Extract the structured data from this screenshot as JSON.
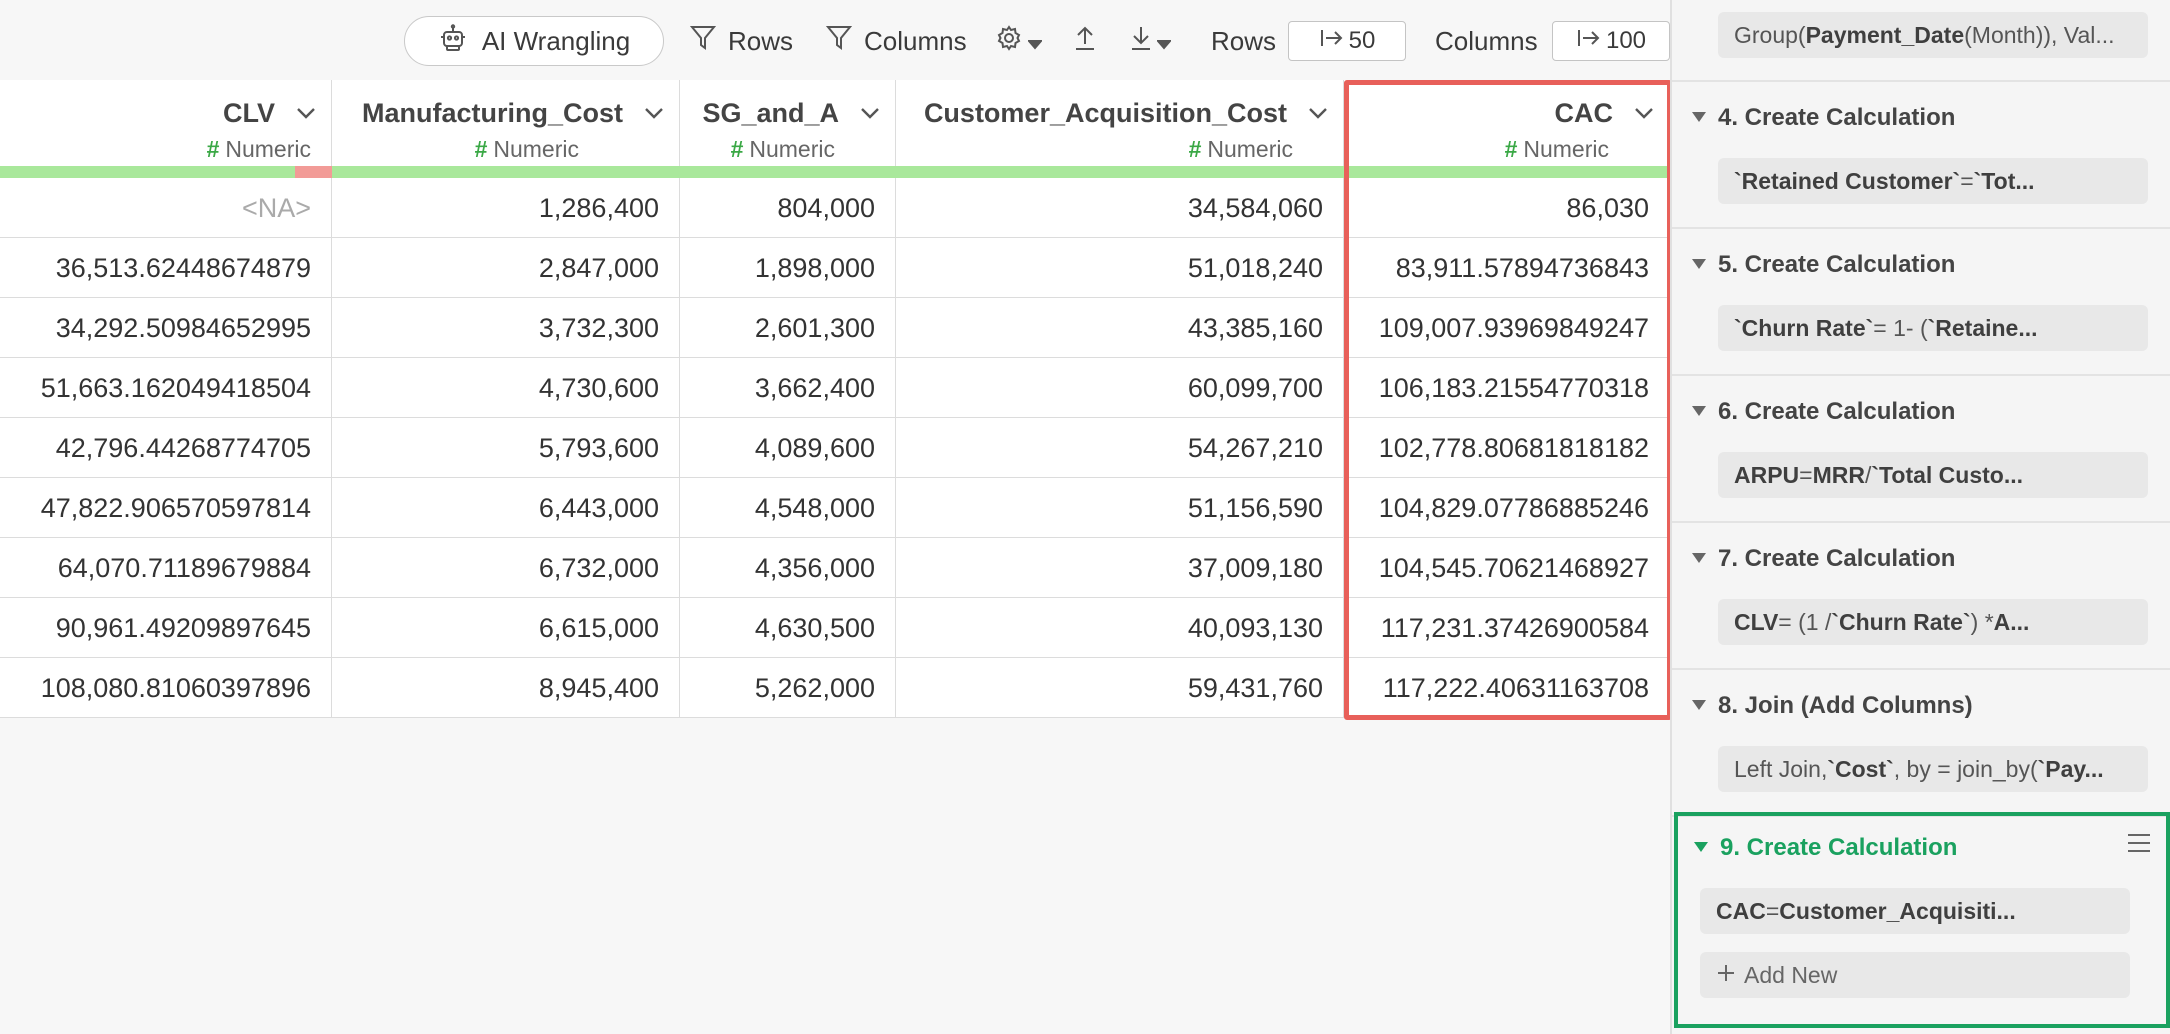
{
  "toolbar": {
    "ai_wrangling_label": "AI Wrangling",
    "rows_filter_label": "Rows",
    "columns_filter_label": "Columns",
    "rows_label": "Rows",
    "rows_value": "50",
    "columns_label": "Columns",
    "columns_value": "100"
  },
  "table": {
    "columns": [
      {
        "name": "CLV",
        "type": "Numeric"
      },
      {
        "name": "Manufacturing_Cost",
        "type": "Numeric"
      },
      {
        "name": "SG_and_A",
        "type": "Numeric"
      },
      {
        "name": "Customer_Acquisition_Cost",
        "type": "Numeric"
      },
      {
        "name": "CAC",
        "type": "Numeric"
      }
    ],
    "rows": [
      [
        "<NA>",
        "1,286,400",
        "804,000",
        "34,584,060",
        "86,030"
      ],
      [
        "36,513.62448674879",
        "2,847,000",
        "1,898,000",
        "51,018,240",
        "83,911.57894736843"
      ],
      [
        "34,292.50984652995",
        "3,732,300",
        "2,601,300",
        "43,385,160",
        "109,007.93969849247"
      ],
      [
        "51,663.162049418504",
        "4,730,600",
        "3,662,400",
        "60,099,700",
        "106,183.21554770318"
      ],
      [
        "42,796.44268774705",
        "5,793,600",
        "4,089,600",
        "54,267,210",
        "102,778.80681818182"
      ],
      [
        "47,822.906570597814",
        "6,443,000",
        "4,548,000",
        "51,156,590",
        "104,829.07786885246"
      ],
      [
        "64,070.71189679884",
        "6,732,000",
        "4,356,000",
        "37,009,180",
        "104,545.70621468927"
      ],
      [
        "90,961.49209897645",
        "6,615,000",
        "4,630,500",
        "40,093,130",
        "117,231.37426900584"
      ],
      [
        "108,080.81060397896",
        "8,945,400",
        "5,262,000",
        "59,431,760",
        "117,222.40631163708"
      ]
    ]
  },
  "steps": {
    "top_expr": "Group(<b>Payment_Date</b> (Month)), Val...",
    "items": [
      {
        "title": "4. Create Calculation",
        "expr": "<b>`Retained Customer`</b> = <b>`Tot...</b>"
      },
      {
        "title": "5. Create Calculation",
        "expr": "<b>`Churn Rate`</b> = 1- (<b>`Retaine...</b>"
      },
      {
        "title": "6. Create Calculation",
        "expr": "<b>ARPU</b> = <b>MRR</b> / <b>`Total Custo...</b>"
      },
      {
        "title": "7. Create Calculation",
        "expr": "<b>CLV</b> = (1 / <b>`Churn Rate`</b>) * <b>A...</b>"
      },
      {
        "title": "8. Join (Add Columns)",
        "expr": "Left Join, <b>`Cost`</b>, by = join_by(<b>`Pay...</b>"
      }
    ],
    "active": {
      "title": "9. Create Calculation",
      "expr": "<b>CAC</b> = <b>Customer_Acquisiti...</b>",
      "add_new_label": "Add New"
    }
  },
  "colors": {
    "highlight": "#e8605a",
    "active_step": "#1aa15f",
    "quality_ok": "#a9e89b",
    "quality_missing": "#f29b97",
    "numeric_hash": "#3aa845"
  }
}
